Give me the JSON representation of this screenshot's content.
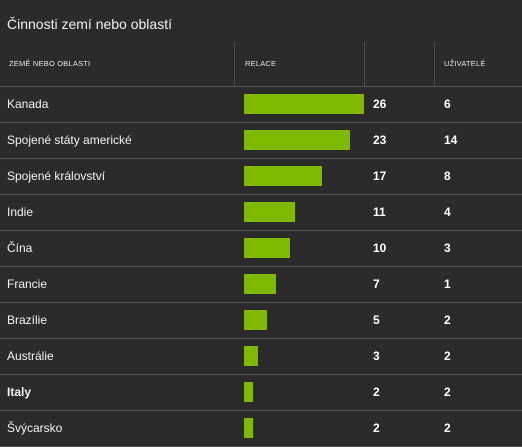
{
  "panel": {
    "title": "Činnosti zemí nebo oblastí"
  },
  "table": {
    "columns": {
      "country": "ZEMĚ NEBO OBLASTI",
      "sessions": "RELACE",
      "users": "UŽIVATELÉ"
    },
    "bar_color": "#7fba00",
    "max_sessions": 26,
    "rows": [
      {
        "country": "Kanada",
        "sessions": 26,
        "users": 6
      },
      {
        "country": "Spojené státy americké",
        "sessions": 23,
        "users": 14
      },
      {
        "country": "Spojené království",
        "sessions": 17,
        "users": 8
      },
      {
        "country": "Indie",
        "sessions": 11,
        "users": 4
      },
      {
        "country": "Čína",
        "sessions": 10,
        "users": 3
      },
      {
        "country": "Francie",
        "sessions": 7,
        "users": 1
      },
      {
        "country": "Brazílie",
        "sessions": 5,
        "users": 2
      },
      {
        "country": "Austrálie",
        "sessions": 3,
        "users": 2
      },
      {
        "country": "Italy",
        "sessions": 2,
        "users": 2,
        "emphasis": true
      },
      {
        "country": "Švýcarsko",
        "sessions": 2,
        "users": 2
      }
    ]
  }
}
